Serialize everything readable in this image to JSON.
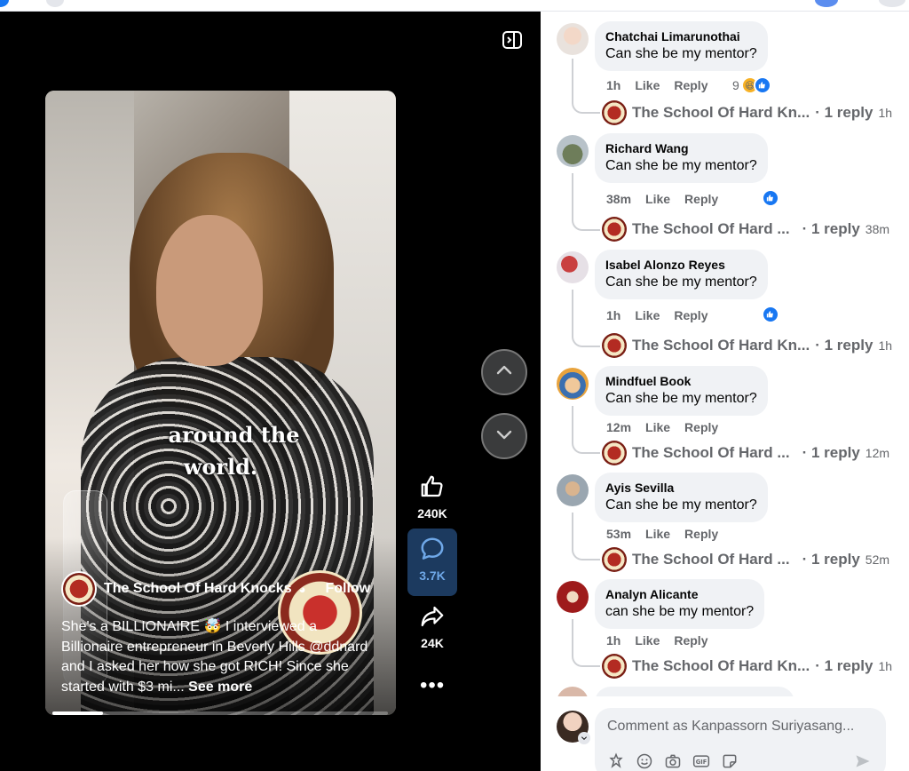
{
  "reel": {
    "overlay_caption_line1": "around the",
    "overlay_caption_line2": "world.",
    "author": "The School Of Hard Knocks",
    "follow_label": "Follow",
    "description": "She's a BILLIONAIRE 🤯 I interviewed a Billionaire entrepreneur in Beverly Hills @ddnard and I asked her how she got RICH! Since she started with $3 mi...",
    "see_more": "See more",
    "progress": 0.15
  },
  "actions": {
    "like_count": "240K",
    "comment_count": "3.7K",
    "share_count": "24K",
    "more_label": "•••"
  },
  "comments": [
    {
      "name": "Chatchai Limarunothai",
      "text": "Can she be my mentor?",
      "time": "1h",
      "like": "Like",
      "reply": "Reply",
      "reactions": "9",
      "reply_author": "The School Of Hard Kn...",
      "reply_count": "· 1 reply",
      "reply_time": "1h"
    },
    {
      "name": "Richard Wang",
      "text": "Can she be my mentor?",
      "time": "38m",
      "like": "Like",
      "reply": "Reply",
      "reactions": "",
      "reply_author": "The School Of Hard ...",
      "reply_count": "· 1 reply",
      "reply_time": "38m"
    },
    {
      "name": "Isabel Alonzo Reyes",
      "text": "Can she be my mentor?",
      "time": "1h",
      "like": "Like",
      "reply": "Reply",
      "reactions": "",
      "reply_author": "The School Of Hard Kn...",
      "reply_count": "· 1 reply",
      "reply_time": "1h"
    },
    {
      "name": "Mindfuel Book",
      "text": "Can she be my mentor?",
      "time": "12m",
      "like": "Like",
      "reply": "Reply",
      "reactions": "",
      "reply_author": "The School Of Hard ...",
      "reply_count": "· 1 reply",
      "reply_time": "12m"
    },
    {
      "name": "Ayis Sevilla",
      "text": "Can she be my mentor?",
      "time": "53m",
      "like": "Like",
      "reply": "Reply",
      "reactions": "",
      "reply_author": "The School Of Hard ...",
      "reply_count": "· 1 reply",
      "reply_time": "52m"
    },
    {
      "name": "Analyn Alicante",
      "text": "can she be my mentor?",
      "time": "1h",
      "like": "Like",
      "reply": "Reply",
      "reactions": "",
      "reply_author": "The School Of Hard Kn...",
      "reply_count": "· 1 reply",
      "reply_time": "1h"
    }
  ],
  "composer": {
    "placeholder": "Comment as Kanpassorn Suriyasang..."
  },
  "colors": {
    "accent": "#1877f2",
    "video_bg": "#000000",
    "bubble_bg": "#f0f2f5",
    "muted_text": "#65676b"
  }
}
